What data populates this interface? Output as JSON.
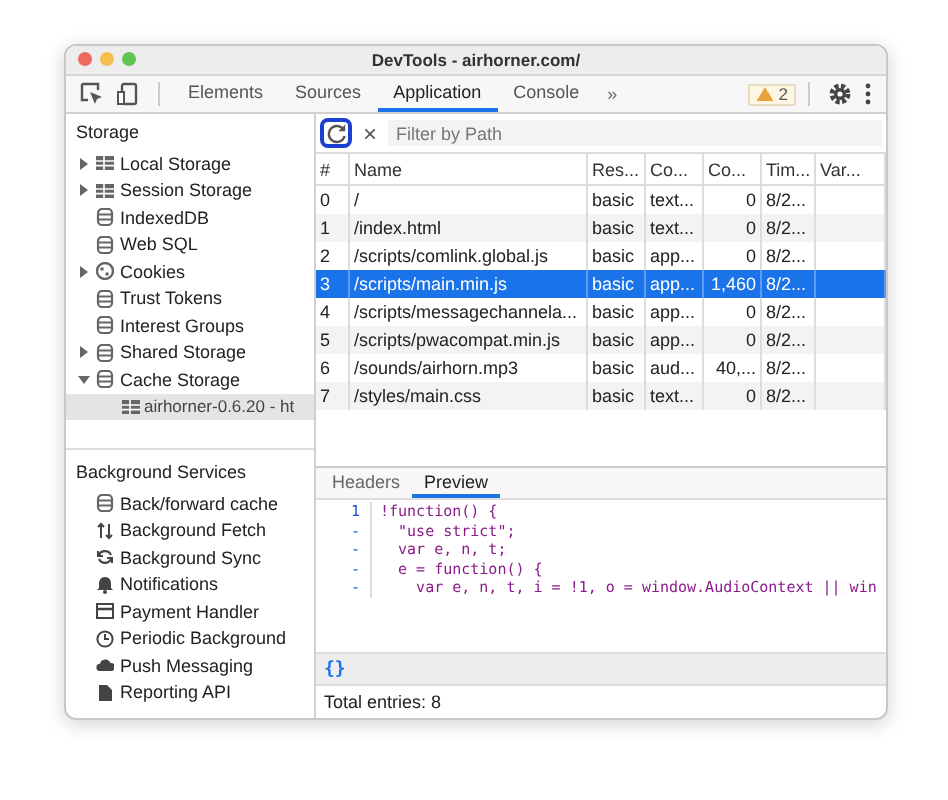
{
  "window": {
    "title": "DevTools - airhorner.com/"
  },
  "toolbar": {
    "tabs": [
      {
        "label": "Elements",
        "selected": false
      },
      {
        "label": "Sources",
        "selected": false
      },
      {
        "label": "Application",
        "selected": true
      },
      {
        "label": "Console",
        "selected": false
      }
    ],
    "more": "»",
    "warnings": "2"
  },
  "sidebar": {
    "sections": [
      {
        "title": "Storage",
        "items": [
          {
            "label": "Local Storage",
            "kind": "expandable",
            "expanded": false,
            "selected": false
          },
          {
            "label": "Session Storage",
            "kind": "expandable",
            "expanded": false,
            "selected": false
          },
          {
            "label": "IndexedDB",
            "kind": "leaf",
            "selected": false
          },
          {
            "label": "Web SQL",
            "kind": "leaf",
            "selected": false
          },
          {
            "label": "Cookies",
            "kind": "expandable",
            "expanded": false,
            "selected": false
          },
          {
            "label": "Trust Tokens",
            "kind": "leaf",
            "selected": false
          },
          {
            "label": "Interest Groups",
            "kind": "leaf",
            "selected": false
          },
          {
            "label": "Shared Storage",
            "kind": "expandable",
            "expanded": false,
            "selected": false
          },
          {
            "label": "Cache Storage",
            "kind": "expandable",
            "expanded": true,
            "selected": false,
            "children": [
              {
                "label": "airhorner-0.6.20 - ht",
                "selected": true
              }
            ]
          }
        ]
      },
      {
        "title": "Background Services",
        "items": [
          {
            "label": "Back/forward cache",
            "kind": "leaf",
            "selected": false
          },
          {
            "label": "Background Fetch",
            "kind": "leaf",
            "selected": false
          },
          {
            "label": "Background Sync",
            "kind": "leaf",
            "selected": false
          },
          {
            "label": "Notifications",
            "kind": "leaf",
            "selected": false
          },
          {
            "label": "Payment Handler",
            "kind": "leaf",
            "selected": false
          },
          {
            "label": "Periodic Background",
            "kind": "leaf",
            "selected": false
          },
          {
            "label": "Push Messaging",
            "kind": "leaf",
            "selected": false
          },
          {
            "label": "Reporting API",
            "kind": "leaf",
            "selected": false
          }
        ]
      }
    ]
  },
  "filter": {
    "clear": "×",
    "placeholder": "Filter by Path"
  },
  "table": {
    "columns": [
      "#",
      "Name",
      "Res...",
      "Co...",
      "Co...",
      "Tim...",
      "Var..."
    ],
    "rows": [
      {
        "cells": [
          "0",
          "/",
          "basic",
          "text...",
          "0",
          "8/2...",
          ""
        ],
        "selected": false
      },
      {
        "cells": [
          "1",
          "/index.html",
          "basic",
          "text...",
          "0",
          "8/2...",
          ""
        ],
        "selected": false
      },
      {
        "cells": [
          "2",
          "/scripts/comlink.global.js",
          "basic",
          "app...",
          "0",
          "8/2...",
          ""
        ],
        "selected": false
      },
      {
        "cells": [
          "3",
          "/scripts/main.min.js",
          "basic",
          "app...",
          "1,460",
          "8/2...",
          ""
        ],
        "selected": true
      },
      {
        "cells": [
          "4",
          "/scripts/messagechannela...",
          "basic",
          "app...",
          "0",
          "8/2...",
          ""
        ],
        "selected": false
      },
      {
        "cells": [
          "5",
          "/scripts/pwacompat.min.js",
          "basic",
          "app...",
          "0",
          "8/2...",
          ""
        ],
        "selected": false
      },
      {
        "cells": [
          "6",
          "/sounds/airhorn.mp3",
          "basic",
          "aud...",
          "40,...",
          "8/2...",
          ""
        ],
        "selected": false
      },
      {
        "cells": [
          "7",
          "/styles/main.css",
          "basic",
          "text...",
          "0",
          "8/2...",
          ""
        ],
        "selected": false
      }
    ]
  },
  "detail": {
    "tabs": [
      {
        "label": "Headers",
        "selected": false
      },
      {
        "label": "Preview",
        "selected": true
      }
    ],
    "lines": [
      {
        "gutter": "1",
        "text": "!function() {"
      },
      {
        "gutter": "-",
        "text": "  \"use strict\";"
      },
      {
        "gutter": "-",
        "text": "  var e, n, t;"
      },
      {
        "gutter": "-",
        "text": "  e = function() {"
      },
      {
        "gutter": "-",
        "text": "    var e, n, t, i = !1, o = window.AudioContext || win"
      }
    ],
    "format": "{}"
  },
  "status_bar": "Total entries: 8"
}
